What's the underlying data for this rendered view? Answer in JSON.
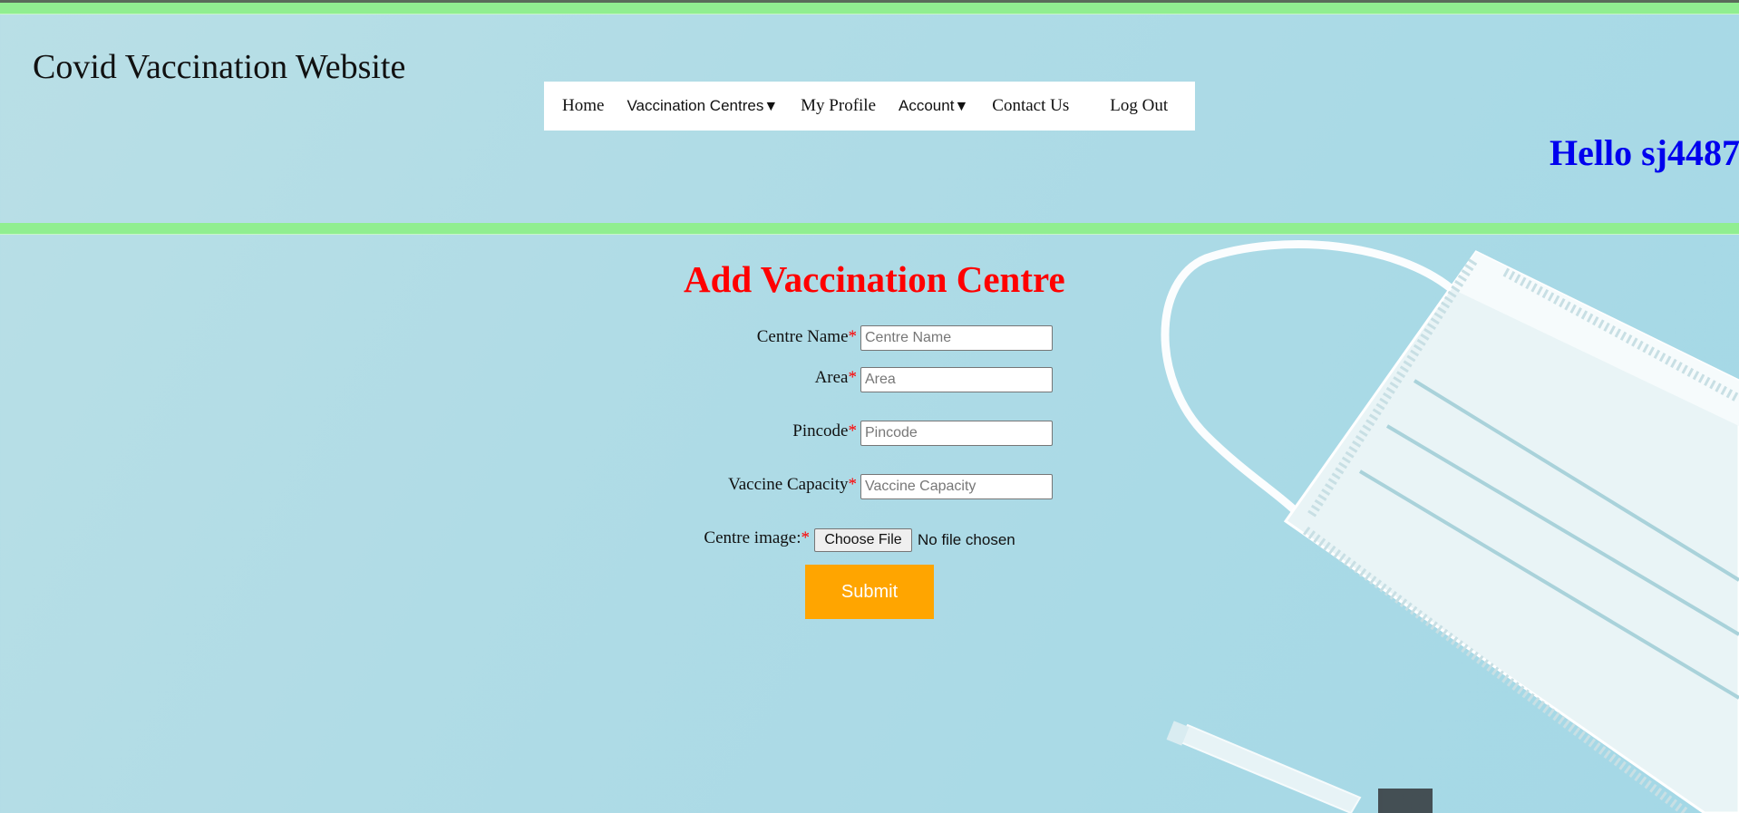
{
  "site": {
    "title": "Covid Vaccination Website"
  },
  "nav": {
    "home": "Home",
    "vaccination_centres": "Vaccination Centres",
    "my_profile": "My Profile",
    "account": "Account",
    "contact_us": "Contact Us",
    "log_out": "Log Out",
    "caret": "▼"
  },
  "greeting": "Hello sj4487",
  "form": {
    "title": "Add Vaccination Centre",
    "required_mark": "*",
    "centre_name": {
      "label": "Centre Name",
      "placeholder": "Centre Name",
      "value": ""
    },
    "area": {
      "label": "Area",
      "placeholder": "Area",
      "value": ""
    },
    "pincode": {
      "label": "Pincode",
      "placeholder": "Pincode",
      "value": ""
    },
    "vaccine_capacity": {
      "label": "Vaccine Capacity",
      "placeholder": "Vaccine Capacity",
      "value": ""
    },
    "centre_image": {
      "label": "Centre image:",
      "button": "Choose File",
      "status": "No file chosen"
    },
    "submit": "Submit"
  },
  "colors": {
    "accent_bar": "#90ee90",
    "title_red": "#ff0000",
    "greeting_blue": "#0000ee",
    "submit_orange": "#ffa500"
  }
}
